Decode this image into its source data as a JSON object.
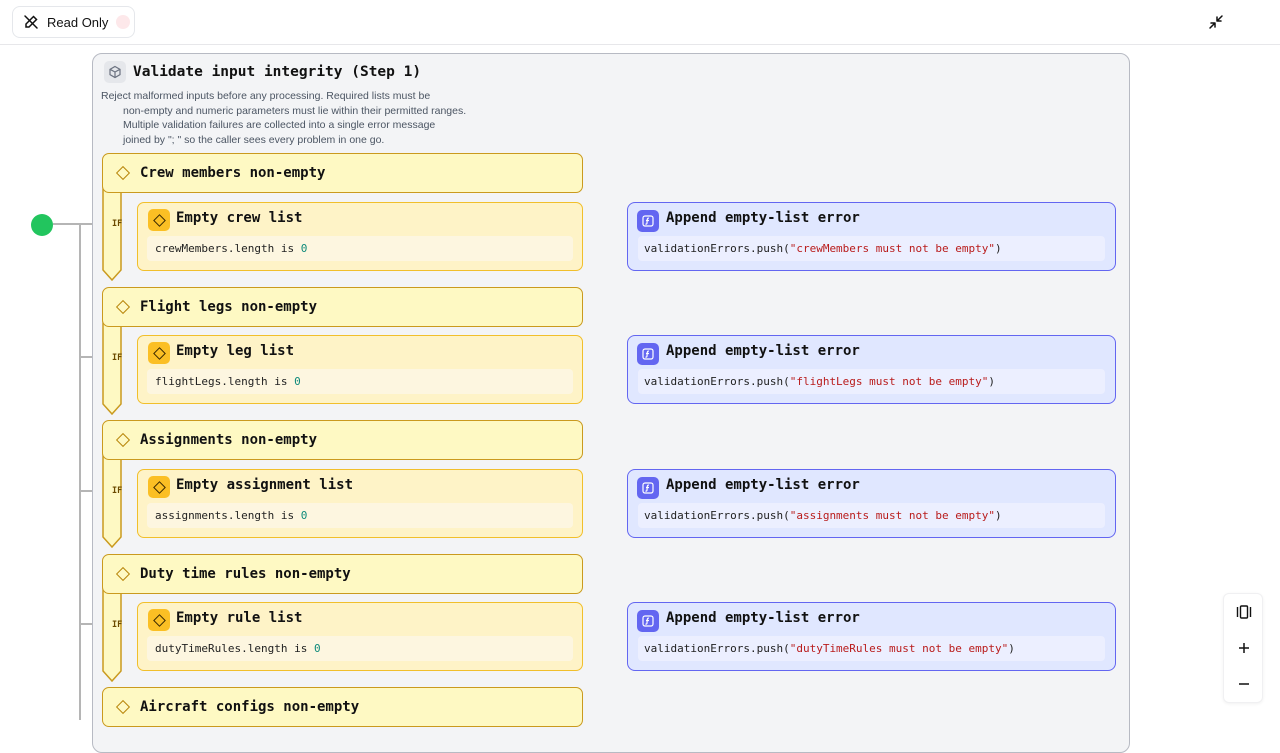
{
  "toolbar": {
    "mode_label": "Read Only"
  },
  "group": {
    "title": "Validate input integrity (Step 1)",
    "description_lines": [
      "Reject malformed inputs before any processing. Required lists must be",
      "non-empty and numeric parameters must lie within their permitted ranges.",
      "Multiple validation failures are collected into a single error message",
      "joined by \"; \" so the caller sees every problem in one go."
    ]
  },
  "blocks": [
    {
      "if_title": "Crew members non-empty",
      "if_badge": "IF",
      "cond_title": "Empty crew list",
      "cond_expr": "crewMembers.length is ",
      "cond_value": "0",
      "action_title": "Append empty-list error",
      "action_prefix": "validationErrors.push(",
      "action_arg": "\"crewMembers must not be empty\"",
      "action_suffix": ")"
    },
    {
      "if_title": "Flight legs non-empty",
      "if_badge": "IF",
      "cond_title": "Empty leg list",
      "cond_expr": "flightLegs.length is ",
      "cond_value": "0",
      "action_title": "Append empty-list error",
      "action_prefix": "validationErrors.push(",
      "action_arg": "\"flightLegs must not be empty\"",
      "action_suffix": ")"
    },
    {
      "if_title": "Assignments non-empty",
      "if_badge": "IF",
      "cond_title": "Empty assignment list",
      "cond_expr": "assignments.length is ",
      "cond_value": "0",
      "action_title": "Append empty-list error",
      "action_prefix": "validationErrors.push(",
      "action_arg": "\"assignments must not be empty\"",
      "action_suffix": ")"
    },
    {
      "if_title": "Duty time rules non-empty",
      "if_badge": "IF",
      "cond_title": "Empty rule list",
      "cond_expr": "dutyTimeRules.length is ",
      "cond_value": "0",
      "action_title": "Append empty-list error",
      "action_prefix": "validationErrors.push(",
      "action_arg": "\"dutyTimeRules must not be empty\"",
      "action_suffix": ")"
    },
    {
      "if_title": "Aircraft configs non-empty"
    }
  ],
  "colors": {
    "start_node": "#22c55e",
    "if_fill": "#fef9c3",
    "if_border": "#ca9a1e",
    "action_fill": "#e0e7ff",
    "action_border": "#6366f1"
  },
  "icons": [
    "pencil-off-icon",
    "collapse-icon",
    "cube-icon",
    "diamond-icon",
    "function-icon",
    "fit-view-icon",
    "zoom-in-icon",
    "zoom-out-icon"
  ]
}
